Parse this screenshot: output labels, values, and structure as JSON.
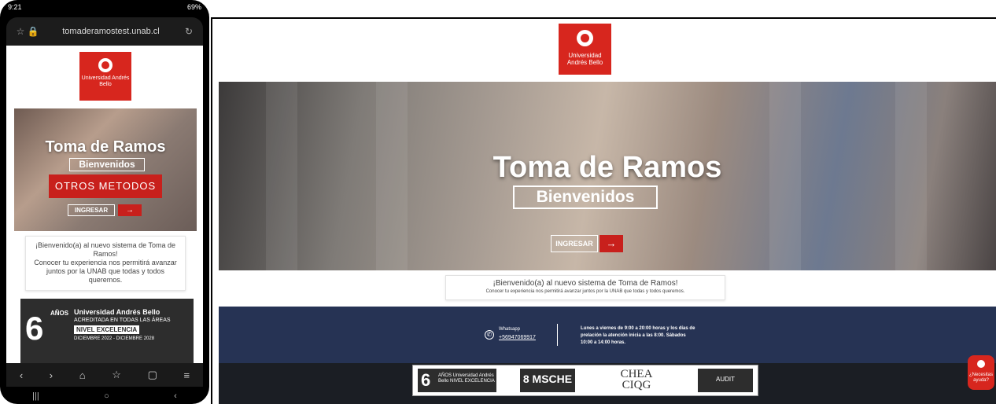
{
  "colors": {
    "brand_red": "#d7261e",
    "footer_navy": "#263354",
    "footer_dark": "#1b1e24"
  },
  "phone": {
    "status": {
      "time": "9:21",
      "right": "69%"
    },
    "url": "tomaderamostest.unab.cl",
    "logo_text": "Universidad Andrés Bello",
    "hero": {
      "title": "Toma de Ramos",
      "subtitle": "Bienvenidos",
      "other_methods": "OTROS METODOS",
      "ingresar": "INGRESAR",
      "arrow": "→"
    },
    "welcome": {
      "line1": "¡Bienvenido(a) al nuevo sistema de Toma de Ramos!",
      "line2": "Conocer tu experiencia nos permitirá avanzar juntos por la UNAB que todas y todos queremos."
    },
    "accreditation": {
      "years": "6",
      "anos": "AÑOS",
      "university": "Universidad Andrés Bello",
      "acreditada": "ACREDITADA EN TODAS LAS ÁREAS",
      "nivel": "NIVEL EXCELENCIA",
      "fecha": "DICIEMBRE 2022 - DICIEMBRE 2028"
    },
    "nav_icons": [
      "back-icon",
      "forward-icon",
      "home-icon",
      "star-icon",
      "tabs-icon",
      "menu-icon"
    ],
    "sys_icons": [
      "recents-icon",
      "home-button-icon",
      "back-button-icon"
    ]
  },
  "desktop": {
    "logo_text": "Universidad Andrés Bello",
    "hero": {
      "title": "Toma de Ramos",
      "subtitle": "Bienvenidos",
      "ingresar": "INGRESAR",
      "arrow": "→"
    },
    "welcome": {
      "line1": "¡Bienvenido(a) al nuevo sistema de Toma de Ramos!",
      "line2": "Conocer tu experiencia nos permitirá avanzar juntos por la UNAB que todas y todos queremos."
    },
    "footer": {
      "whatsapp_label": "Whatsapp",
      "whatsapp_number": "+56947069917",
      "hours": "Lunes a viernes de 9:00 a 20:00 horas y los días de prelación la atención inicia a las 8:00. Sábados 10:00 a 14:00 horas."
    },
    "accreditations": {
      "unab_years": "6",
      "unab_text": "AÑOS Universidad Andrés Bello NIVEL EXCELENCIA",
      "msche": "8 MSCHE",
      "chea": "CHEA",
      "ciqg": "CIQG",
      "aunidt": "AUDIT"
    },
    "help_label": "¿Necesitas ayuda?"
  }
}
